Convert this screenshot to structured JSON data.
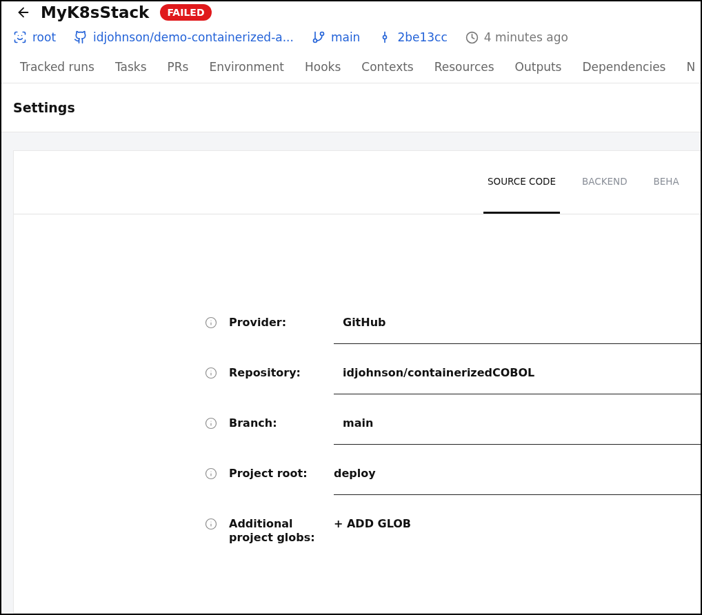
{
  "header": {
    "title": "MyK8sStack",
    "status": {
      "label": "FAILED",
      "kind": "failed"
    }
  },
  "meta": [
    {
      "kind": "space",
      "text": "root"
    },
    {
      "kind": "repo",
      "text": "idjohnson/demo-containerized-a..."
    },
    {
      "kind": "branch",
      "text": "main"
    },
    {
      "kind": "commit",
      "text": "2be13cc"
    },
    {
      "kind": "time",
      "text": "4 minutes ago"
    }
  ],
  "nav_tabs": [
    {
      "label": "Tracked runs",
      "selected": false
    },
    {
      "label": "Tasks",
      "selected": false
    },
    {
      "label": "PRs",
      "selected": false
    },
    {
      "label": "Environment",
      "selected": false
    },
    {
      "label": "Hooks",
      "selected": false
    },
    {
      "label": "Contexts",
      "selected": false
    },
    {
      "label": "Resources",
      "selected": false
    },
    {
      "label": "Outputs",
      "selected": false
    },
    {
      "label": "Dependencies",
      "selected": false
    },
    {
      "label": "N",
      "selected": false
    }
  ],
  "section_title": "Settings",
  "settings_tabs": [
    {
      "label": "SOURCE CODE",
      "selected": true
    },
    {
      "label": "BACKEND",
      "selected": false
    },
    {
      "label": "BEHA",
      "selected": false
    }
  ],
  "fields": [
    {
      "label": "Provider:",
      "kind": "select",
      "value": "GitHub"
    },
    {
      "label": "Repository:",
      "kind": "select",
      "value": "idjohnson/containerizedCOBOL"
    },
    {
      "label": "Branch:",
      "kind": "select",
      "value": "main"
    },
    {
      "label": "Project root:",
      "kind": "input",
      "value": "deploy"
    },
    {
      "label": "Additional project globs:",
      "kind": "button",
      "value": "+ ADD GLOB"
    }
  ]
}
